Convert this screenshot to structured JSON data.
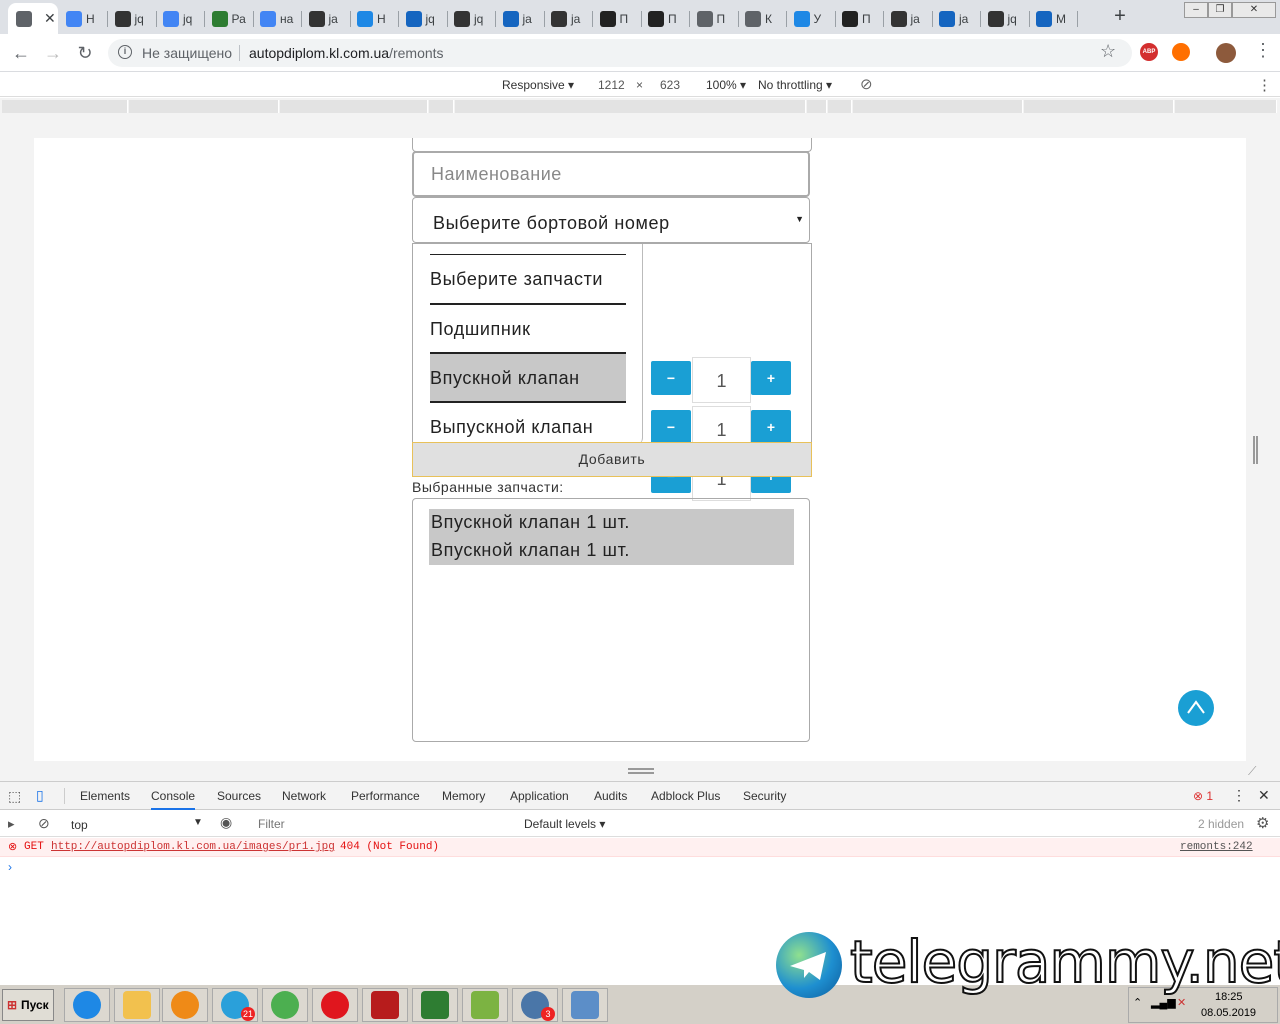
{
  "browser": {
    "tabs": [
      {
        "title": "",
        "icon": "chrome-icon",
        "color": "#5f6368",
        "active": true
      },
      {
        "title": "Н",
        "icon": "google-icon",
        "color": "#4285f4"
      },
      {
        "title": "jq",
        "icon": "sunglasses-icon",
        "color": "#333333"
      },
      {
        "title": "jq",
        "icon": "google-icon",
        "color": "#4285f4"
      },
      {
        "title": "Ра",
        "icon": "bookmark-icon",
        "color": "#2e7d32"
      },
      {
        "title": "на",
        "icon": "google-icon",
        "color": "#4285f4"
      },
      {
        "title": "ja",
        "icon": "sunglasses-icon",
        "color": "#333333"
      },
      {
        "title": "Н",
        "icon": "network-icon",
        "color": "#1e88e5"
      },
      {
        "title": "jq",
        "icon": "stack-icon",
        "color": "#1565c0"
      },
      {
        "title": "jq",
        "icon": "sunglasses-icon",
        "color": "#333333"
      },
      {
        "title": "ja",
        "icon": "stack-icon",
        "color": "#1565c0"
      },
      {
        "title": "ja",
        "icon": "sunglasses-icon",
        "color": "#333333"
      },
      {
        "title": "П",
        "icon": "clef-icon",
        "color": "#222222"
      },
      {
        "title": "П",
        "icon": "clef-icon",
        "color": "#222222"
      },
      {
        "title": "П",
        "icon": "globe-icon",
        "color": "#5f6368"
      },
      {
        "title": "К",
        "icon": "globe-icon",
        "color": "#5f6368"
      },
      {
        "title": "У",
        "icon": "network-icon",
        "color": "#1e88e5"
      },
      {
        "title": "П",
        "icon": "clef-icon",
        "color": "#222222"
      },
      {
        "title": "ja",
        "icon": "sunglasses-icon",
        "color": "#333333"
      },
      {
        "title": "ja",
        "icon": "stack-icon",
        "color": "#1565c0"
      },
      {
        "title": "jq",
        "icon": "sunglasses-icon",
        "color": "#333333"
      },
      {
        "title": "М",
        "icon": "monitor-icon",
        "color": "#1565c0"
      }
    ],
    "new_tab": "+",
    "security_label": "Не защищено",
    "url_host": "autopdiplom.kl.com.ua",
    "url_path": "/remonts",
    "extensions": [
      {
        "name": "adblock-icon",
        "color": "#d32f2f",
        "label": "ABP"
      },
      {
        "name": "fire-extension-icon",
        "color": "#ff6f00",
        "label": ""
      },
      {
        "name": "profile-avatar",
        "color": "#8d5a3c",
        "label": ""
      }
    ]
  },
  "device_toolbar": {
    "mode": "Responsive",
    "width": "1212",
    "times": "×",
    "height": "623",
    "zoom": "100%",
    "throttling": "No throttling"
  },
  "form": {
    "name_placeholder": "Наименование",
    "board_select": "Выберите бортовой номер",
    "parts": [
      {
        "label": "Выберите запчасти",
        "selected": false,
        "has_qty": false
      },
      {
        "label": "Подшипник",
        "selected": false,
        "has_qty": true,
        "qty": "1"
      },
      {
        "label": "Впускной клапан",
        "selected": true,
        "has_qty": true,
        "qty": "1"
      },
      {
        "label": "Выпускной клапан",
        "selected": false,
        "has_qty": true,
        "qty": "1"
      }
    ],
    "minus": "−",
    "plus": "+",
    "add_button": "Добавить",
    "selected_label": "Выбранные запчасти:",
    "selected_items": [
      "Впускной клапан 1 шт.",
      "Впускной клапан 1 шт."
    ],
    "accent_color": "#1a9fd4"
  },
  "devtools": {
    "tabs": [
      "Elements",
      "Console",
      "Sources",
      "Network",
      "Performance",
      "Memory",
      "Application",
      "Audits",
      "Adblock Plus",
      "Security"
    ],
    "active_tab": "Console",
    "error_count": "1",
    "context": "top",
    "filter_placeholder": "Filter",
    "levels": "Default levels",
    "hidden": "2 hidden",
    "error": {
      "method": "GET",
      "url": "http://autopdiplom.kl.com.ua/images/pr1.jpg",
      "status": "404 (Not Found)",
      "source": "remonts:242"
    },
    "prompt": "›"
  },
  "taskbar": {
    "start_label": "Пуск",
    "apps": [
      {
        "name": "internet-explorer-icon",
        "color": "#1e88e5"
      },
      {
        "name": "folder-icon",
        "color": "#f2c14e"
      },
      {
        "name": "media-player-icon",
        "color": "#ef8a17"
      },
      {
        "name": "telegram-icon",
        "color": "#2aa0da",
        "badge": "21"
      },
      {
        "name": "chrome-taskbar-icon",
        "color": "#4caf50"
      },
      {
        "name": "opera-icon",
        "color": "#e0161e"
      },
      {
        "name": "filezilla-icon",
        "color": "#b71c1c"
      },
      {
        "name": "terminal-icon",
        "color": "#2e7d32"
      },
      {
        "name": "notepad-plus-icon",
        "color": "#7cb342"
      },
      {
        "name": "vk-icon",
        "color": "#4a76a8",
        "badge": "3"
      },
      {
        "name": "control-panel-icon",
        "color": "#5c8ec8"
      }
    ],
    "time": "18:25",
    "date": "08.05.2019"
  },
  "watermark": "telegrammy.net"
}
